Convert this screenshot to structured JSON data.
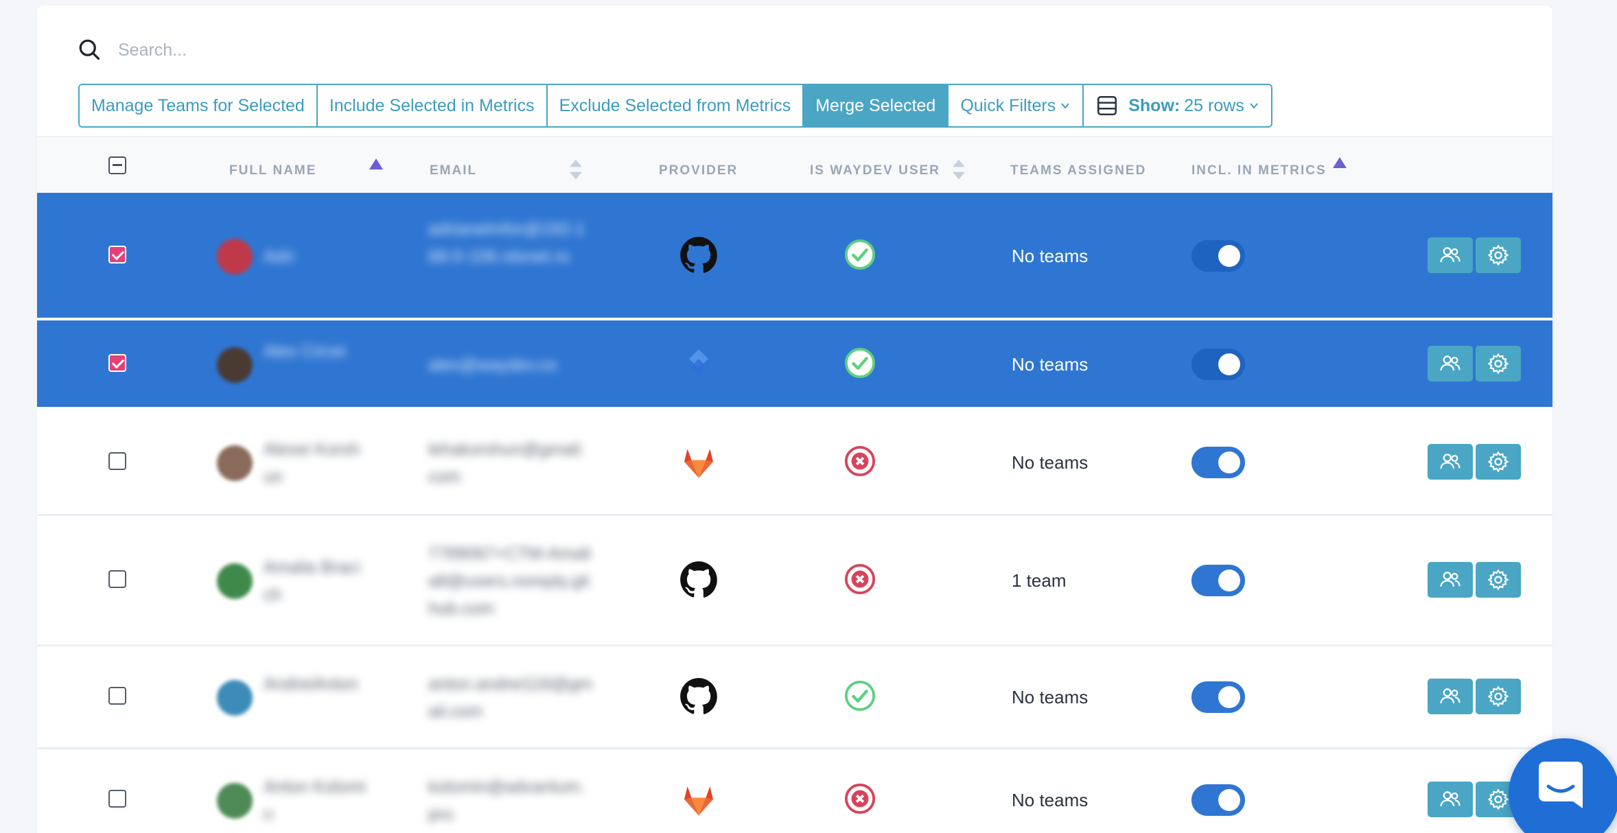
{
  "search": {
    "placeholder": "Search..."
  },
  "toolbar": {
    "manage_teams": "Manage Teams for Selected",
    "include_metrics": "Include Selected in Metrics",
    "exclude_metrics": "Exclude Selected from Metrics",
    "merge": "Merge Selected",
    "quick_filters": "Quick Filters",
    "show_label": "Show:",
    "show_value": "25 rows"
  },
  "columns": {
    "full_name": "FULL NAME",
    "email": "EMAIL",
    "provider": "PROVIDER",
    "is_waydev_user": "IS WAYDEV USER",
    "teams_assigned": "TEAMS ASSIGNED",
    "incl_metrics": "INCL. IN METRICS"
  },
  "rows": [
    {
      "selected": true,
      "name": "Adri",
      "email": "adrianelmfor@192-168-0-106.rdsnet.ro",
      "provider": "github",
      "waydev_user": true,
      "teams": "No teams",
      "included": true
    },
    {
      "selected": true,
      "name": "Alex Circei",
      "email": "alex@waydev.co",
      "provider": "jira",
      "waydev_user": true,
      "teams": "No teams",
      "included": true
    },
    {
      "selected": false,
      "name": "Alexei Korshun",
      "email": "lehakorshun@gmail.com",
      "provider": "gitlab",
      "waydev_user": false,
      "teams": "No teams",
      "included": true
    },
    {
      "selected": false,
      "name": "Amalia Bracich",
      "email": "7789067+CTM-Amalia8@users.noreply.github.com",
      "provider": "github",
      "waydev_user": false,
      "teams": "1 team",
      "included": true
    },
    {
      "selected": false,
      "name": "AndreiAnton",
      "email": "anton.andrei116@gmail.com",
      "provider": "github",
      "waydev_user": true,
      "teams": "No teams",
      "included": true
    },
    {
      "selected": false,
      "name": "Anton Kolomin",
      "email": "kolomin@advantum.pro",
      "provider": "gitlab",
      "waydev_user": false,
      "teams": "No teams",
      "included": true
    }
  ],
  "colors": {
    "accent": "#4aa6c4",
    "selected_row": "#2f76d2",
    "check_pink": "#e3407a",
    "ok_green": "#5fcf80",
    "err_red": "#d9435a"
  },
  "icons": {
    "search": "search-icon",
    "team": "users-icon",
    "settings": "gear-icon",
    "chat": "chat-icon"
  }
}
